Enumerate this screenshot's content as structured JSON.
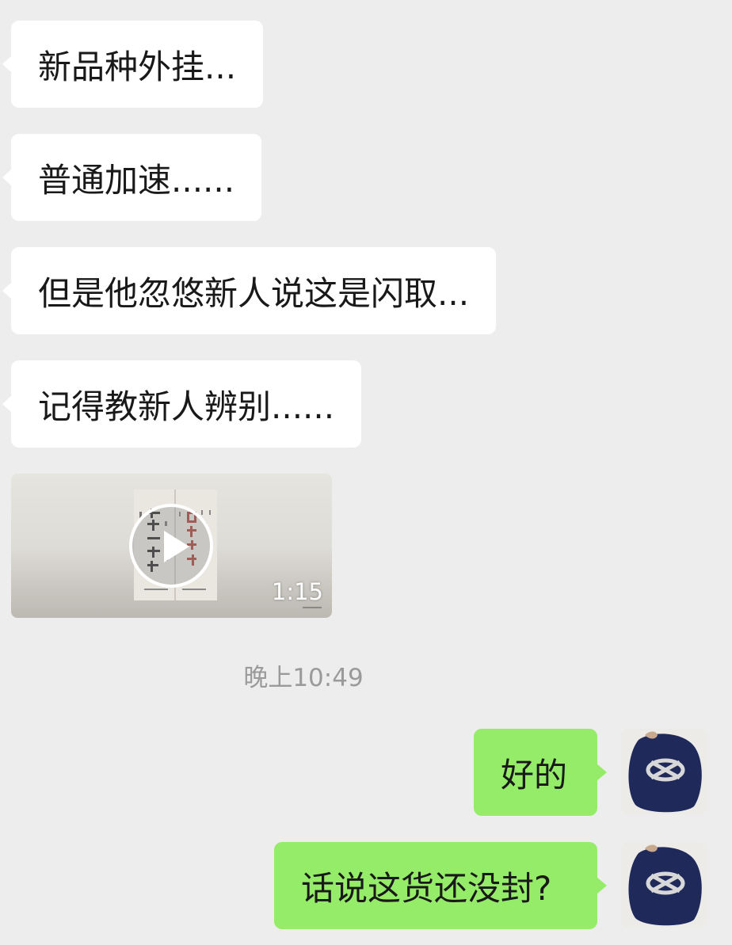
{
  "messages": [
    {
      "side": "left",
      "text": "新品种外挂..."
    },
    {
      "side": "left",
      "text": "普通加速......"
    },
    {
      "side": "left",
      "text": "但是他忽悠新人说这是闪取..."
    },
    {
      "side": "left",
      "text": "记得教新人辨别......"
    },
    {
      "side": "left",
      "type": "video",
      "duration": "1:15"
    },
    {
      "side": "right",
      "text": "好的"
    },
    {
      "side": "right",
      "text": "话说这货还没封?"
    }
  ],
  "timestamp": "晚上10:49",
  "colors": {
    "background": "#ededed",
    "incoming_bubble": "#ffffff",
    "outgoing_bubble": "#95ec69",
    "timestamp_text": "#9a9a9a"
  },
  "icons": {
    "play": "play-icon",
    "avatar": "user-avatar"
  }
}
